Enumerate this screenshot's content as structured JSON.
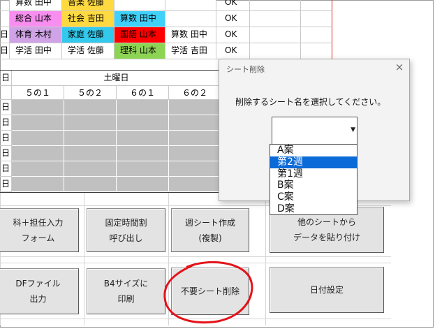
{
  "top_rows": [
    {
      "r": "",
      "c": [
        {
          "t": "算数 田中",
          "bg": "#ffffff"
        },
        {
          "t": "音楽 佐藤",
          "bg": "#ffd940"
        },
        {
          "t": "",
          "bg": "#ffffff"
        },
        {
          "t": "",
          "bg": "#ffffff"
        }
      ],
      "ok": "OK"
    },
    {
      "r": "",
      "c": [
        {
          "t": "総合 山本",
          "bg": "#f78ef0"
        },
        {
          "t": "社会 吉田",
          "bg": "#ffd940"
        },
        {
          "t": "算数 田中",
          "bg": "#3fd1fa"
        },
        {
          "t": "",
          "bg": "#ffffff"
        }
      ],
      "ok": "OK"
    },
    {
      "r": "日",
      "c": [
        {
          "t": "体育 木村",
          "bg": "#d0a3e6"
        },
        {
          "t": "家庭 佐藤",
          "bg": "#33c9ec"
        },
        {
          "t": "国語 山本",
          "bg": "#ff0000"
        },
        {
          "t": "算数 田中",
          "bg": "#ffffff"
        }
      ],
      "ok": "OK"
    },
    {
      "r": "日",
      "c": [
        {
          "t": "学活 田中",
          "bg": "#ffffff"
        },
        {
          "t": "学活 佐藤",
          "bg": "#ffffff"
        },
        {
          "t": "理科 山本",
          "bg": "#8ed454"
        },
        {
          "t": "学活 吉田",
          "bg": "#ffffff"
        }
      ],
      "ok": "OK"
    }
  ],
  "schedule": {
    "corner": "日",
    "day_header": "土曜日",
    "subcols": [
      "５の１",
      "５の２",
      "６の１",
      "６の２"
    ],
    "row_labels": [
      "日",
      "日",
      "日",
      "日",
      "日",
      "日"
    ]
  },
  "buttons": {
    "teacher_form": {
      "l1": "科＋担任入力",
      "l2": "フォーム"
    },
    "fixed_timetable": {
      "l1": "固定時間割",
      "l2": "呼び出し"
    },
    "week_sheet": {
      "l1": "週シート作成",
      "l2": "(複製)"
    },
    "paste_data": {
      "l1": "他のシートから",
      "l2": "データを貼り付け"
    },
    "pdf_output": {
      "l1": "DFファイル",
      "l2": "出力"
    },
    "b4_print": {
      "l1": "B4サイズに",
      "l2": "印刷"
    },
    "delete_sheet": {
      "l1": "不要シート削除"
    },
    "date_setting": {
      "l1": "日付設定"
    }
  },
  "dialog": {
    "title": "シート削除",
    "close": "×",
    "prompt": "削除するシート名を選択してください。",
    "combo_value": "",
    "options": [
      "A案",
      "第2週",
      "第1週",
      "B案",
      "C案",
      "D案"
    ],
    "selected_index": 1
  },
  "colors": {
    "grid": "#c9c9c9",
    "shaded": "#c0c0c0",
    "red_border": "#e02020",
    "annotation": "#e3141a",
    "highlight": "#0a6ad7"
  }
}
